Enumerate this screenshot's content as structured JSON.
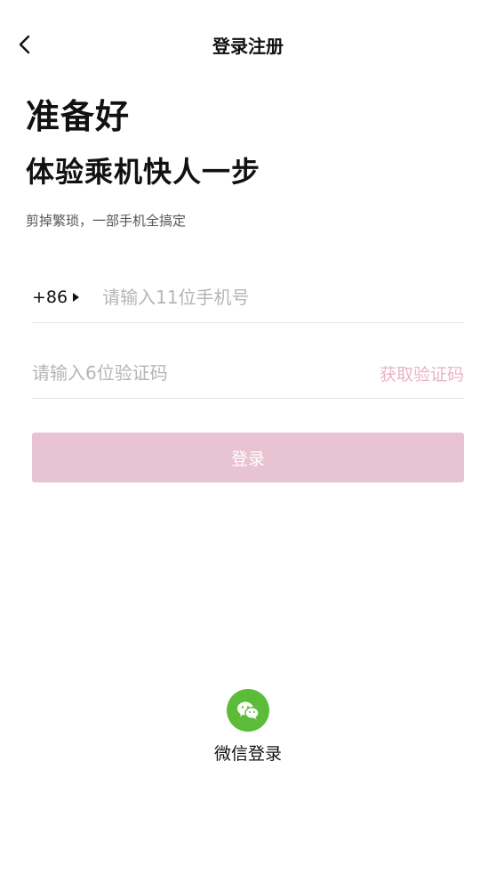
{
  "header": {
    "title": "登录注册",
    "back_icon": "chevron-left-icon"
  },
  "intro": {
    "headline1": "准备好",
    "headline2": "体验乘机快人一步",
    "subtitle": "剪掉繁琐，一部手机全搞定"
  },
  "phone": {
    "country_code": "+86",
    "placeholder": "请输入11位手机号",
    "value": ""
  },
  "code": {
    "placeholder": "请输入6位验证码",
    "value": "",
    "get_code_label": "获取验证码"
  },
  "login_button": {
    "label": "登录"
  },
  "wechat_login": {
    "label": "微信登录",
    "icon": "wechat-icon"
  },
  "colors": {
    "accent_disabled": "#e8c3d1",
    "get_code_text": "#e8b4c6",
    "wechat_green": "#5dbb3a"
  }
}
